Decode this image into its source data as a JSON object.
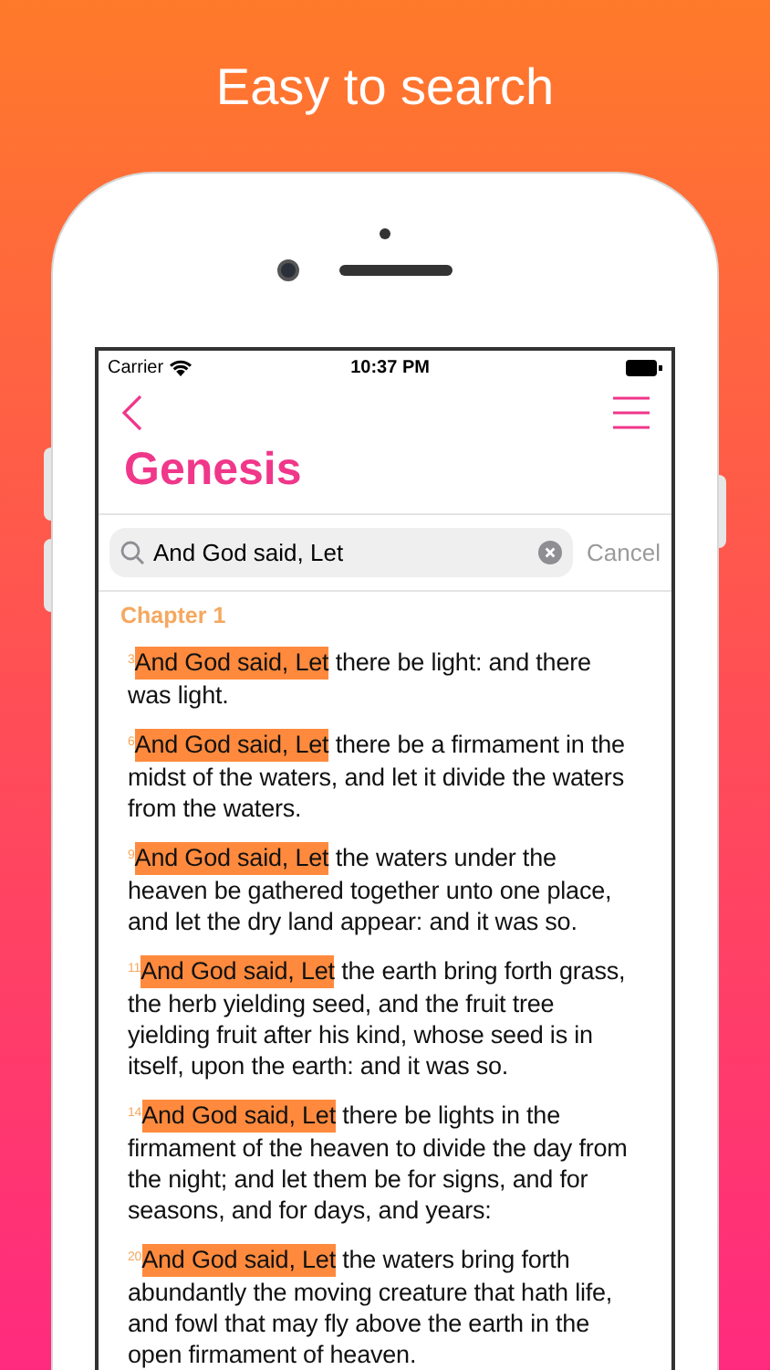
{
  "headline": "Easy to search",
  "status_bar": {
    "carrier": "Carrier",
    "time": "10:37 PM"
  },
  "nav": {
    "title": "Genesis"
  },
  "search": {
    "value": "And God said, Let",
    "cancel": "Cancel"
  },
  "chapter": "Chapter 1",
  "verses": [
    {
      "number": "3",
      "match": "And God said, Let",
      "text": " there be light: and there was light."
    },
    {
      "number": "6",
      "match": "And God said, Let",
      "text": " there be a firmament in the midst of the waters, and let it divide the waters from the waters."
    },
    {
      "number": "9",
      "match": "And God said, Let",
      "text": " the waters under the heaven be gathered together unto one place, and let the dry land appear: and it was so."
    },
    {
      "number": "11",
      "match": "And God said, Let",
      "text": " the earth bring forth grass, the herb yielding seed, and the fruit tree yielding fruit after his kind, whose seed is in itself, upon the earth: and it was so."
    },
    {
      "number": "14",
      "match": "And God said, Let",
      "text": " there be lights in the firmament of the heaven to divide the day from the night; and let them be for signs, and for seasons, and for days, and years:"
    },
    {
      "number": "20",
      "match": "And God said, Let",
      "text": " the waters bring forth abundantly the moving creature that hath life, and fowl that may fly above the earth in the open firmament of heaven."
    }
  ]
}
